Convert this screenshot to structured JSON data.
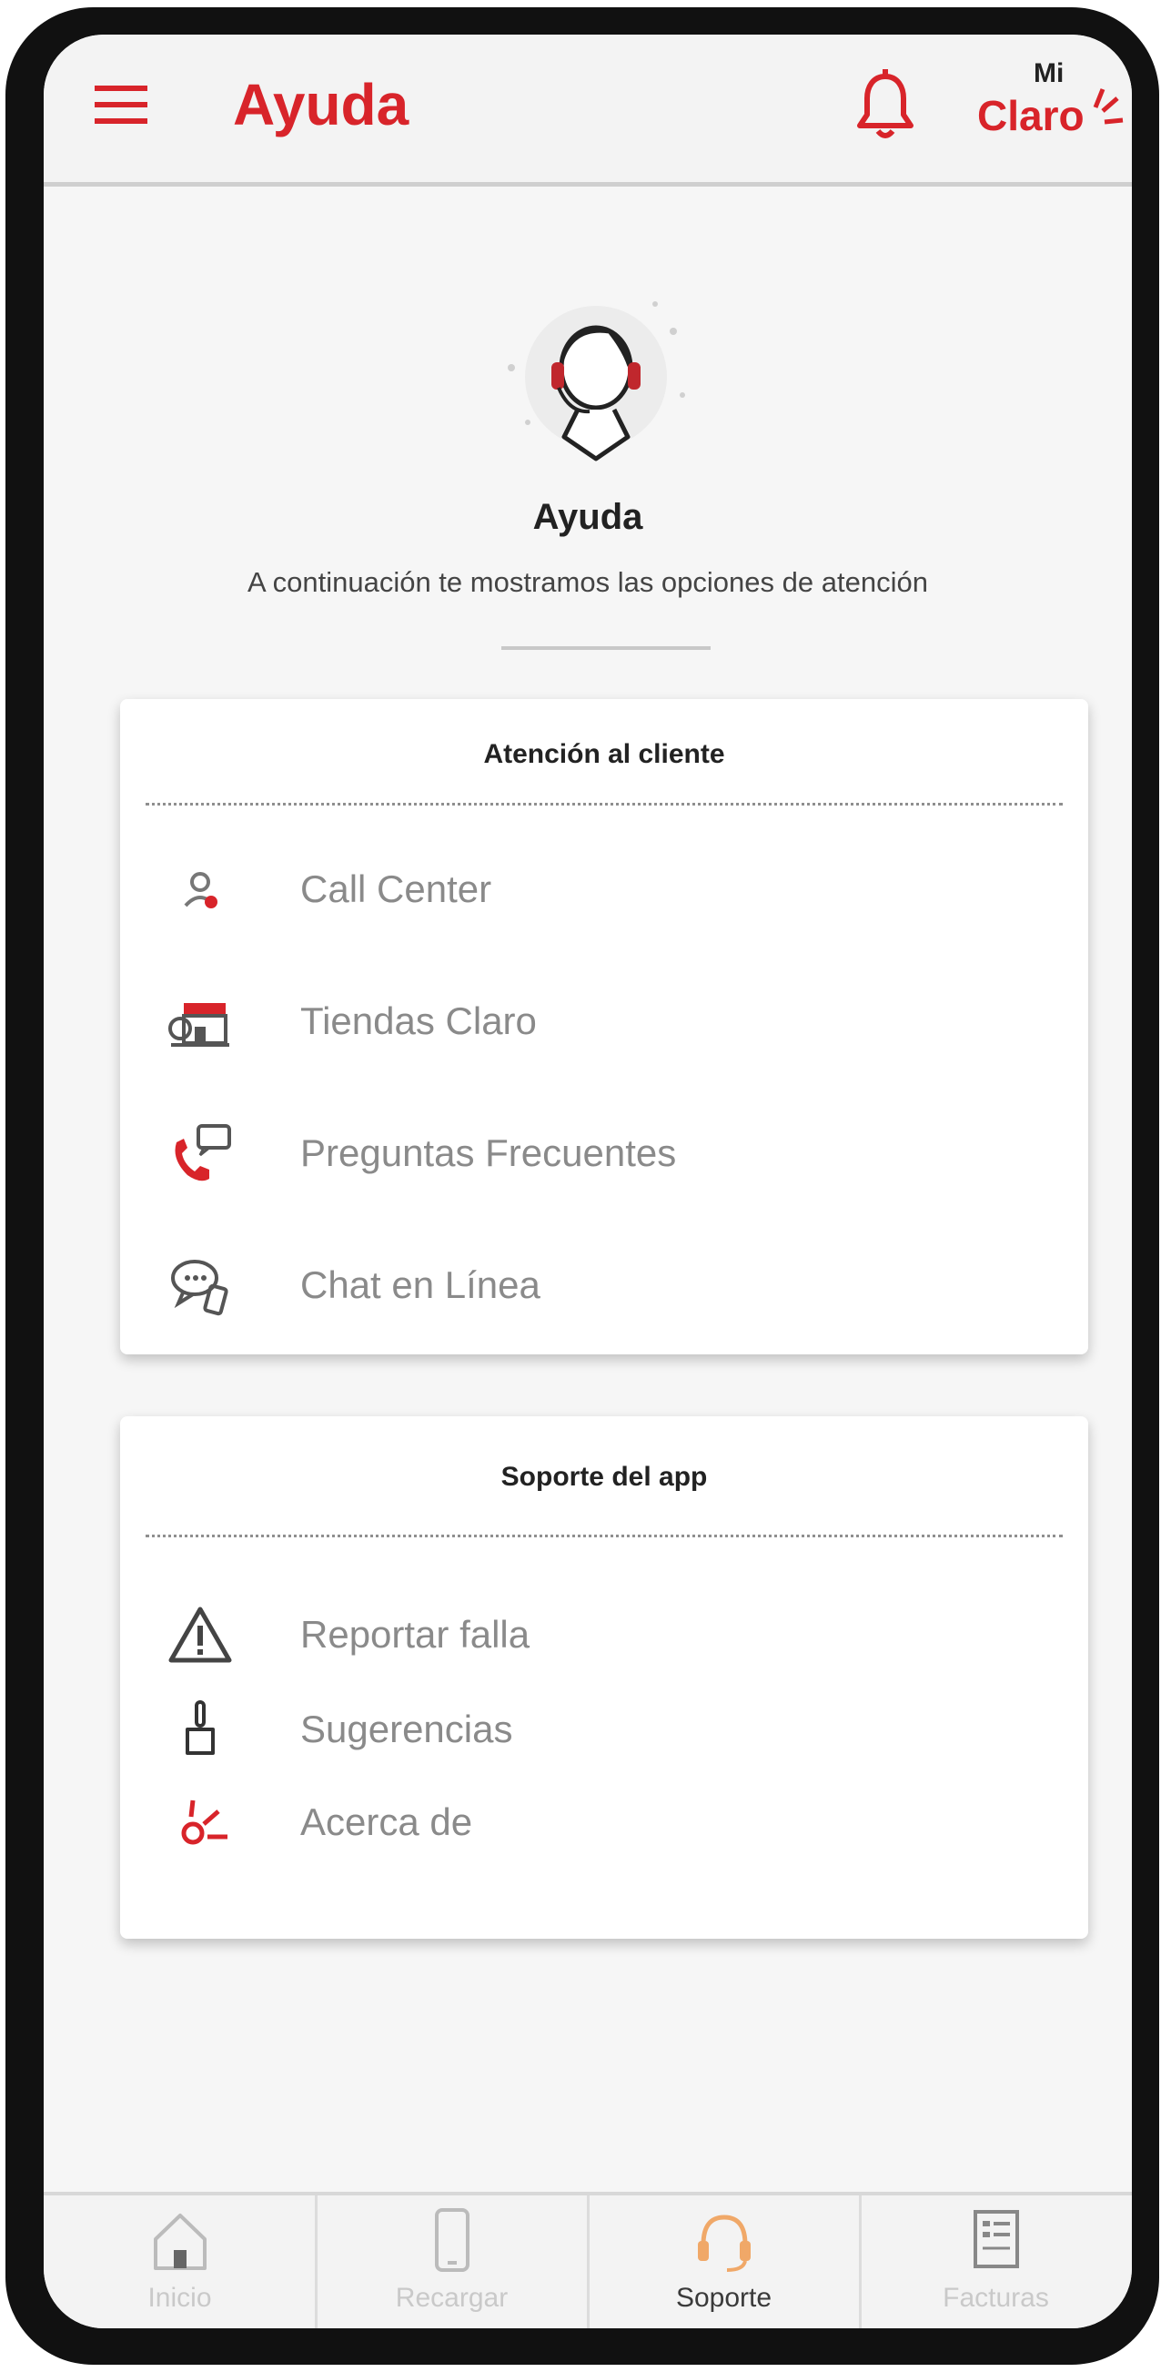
{
  "header": {
    "title": "Ayuda",
    "brand_top": "Mi",
    "brand_main": "Claro"
  },
  "hero": {
    "title": "Ayuda",
    "subtitle": "A continuación te mostramos las opciones de atención"
  },
  "cards": {
    "customer": {
      "title": "Atención al cliente",
      "items": [
        {
          "label": "Call Center",
          "icon": "call-center-icon"
        },
        {
          "label": "Tiendas Claro",
          "icon": "store-icon"
        },
        {
          "label": "Preguntas Frecuentes",
          "icon": "faq-phone-icon"
        },
        {
          "label": "Chat en Línea",
          "icon": "chat-icon"
        }
      ]
    },
    "app": {
      "title": "Soporte del app",
      "items": [
        {
          "label": "Reportar falla",
          "icon": "warning-icon"
        },
        {
          "label": "Sugerencias",
          "icon": "hand-pointer-icon"
        },
        {
          "label": "Acerca de",
          "icon": "claro-about-icon"
        }
      ]
    }
  },
  "bottom_nav": [
    {
      "label": "Inicio",
      "icon": "home-icon"
    },
    {
      "label": "Recargar",
      "icon": "phone-icon"
    },
    {
      "label": "Soporte",
      "icon": "headset-icon",
      "active": true
    },
    {
      "label": "Facturas",
      "icon": "invoice-icon"
    }
  ],
  "colors": {
    "brand_red": "#d8242a",
    "item_text": "#8a8a8a",
    "header_bg": "#f3f3f3"
  }
}
